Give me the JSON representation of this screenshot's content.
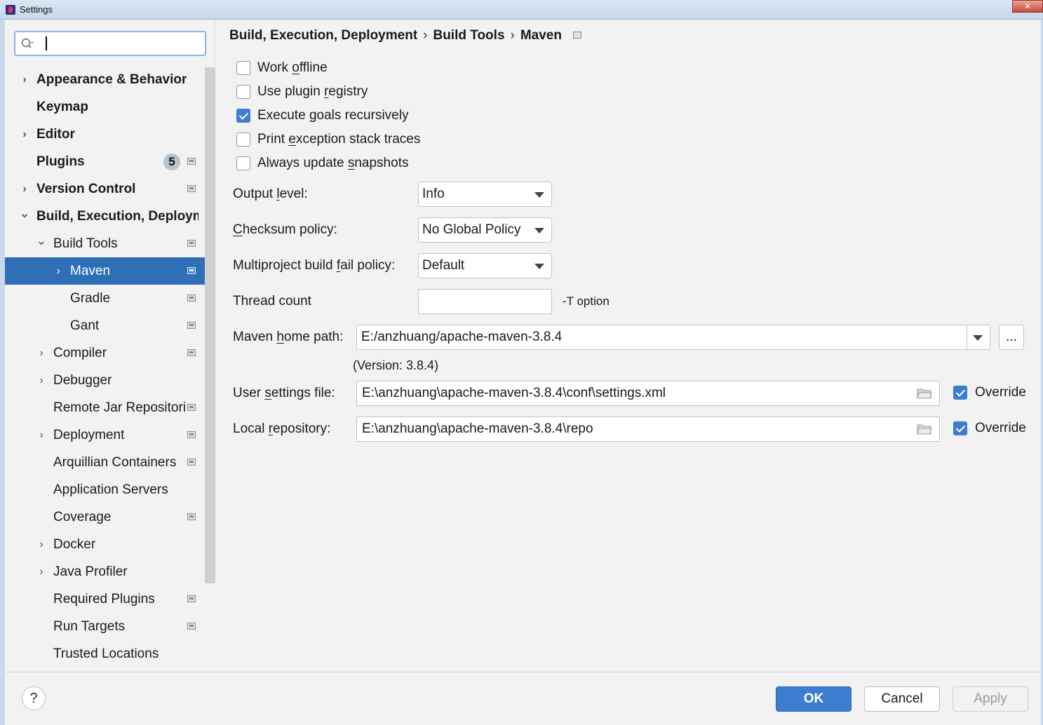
{
  "window": {
    "title": "Settings",
    "close_symbol": "✕"
  },
  "search": {
    "placeholder": "",
    "value": ""
  },
  "sidebar": {
    "items": [
      {
        "label": "Appearance & Behavior",
        "bold": true,
        "chevron": "›",
        "level": 0
      },
      {
        "label": "Keymap",
        "bold": true,
        "chevron": "",
        "level": 0
      },
      {
        "label": "Editor",
        "bold": true,
        "chevron": "›",
        "level": 0
      },
      {
        "label": "Plugins",
        "bold": true,
        "chevron": "",
        "level": 0,
        "badge": "5",
        "project_icon": true
      },
      {
        "label": "Version Control",
        "bold": true,
        "chevron": "›",
        "level": 0,
        "project_icon": true
      },
      {
        "label": "Build, Execution, Deploym",
        "bold": true,
        "chevron": "⌄",
        "level": 0
      },
      {
        "label": "Build Tools",
        "bold": false,
        "chevron": "⌄",
        "level": 1,
        "project_icon": true
      },
      {
        "label": "Maven",
        "bold": false,
        "chevron": "›",
        "level": 2,
        "project_icon": true,
        "selected": true
      },
      {
        "label": "Gradle",
        "bold": false,
        "chevron": "",
        "level": 2,
        "project_icon": true
      },
      {
        "label": "Gant",
        "bold": false,
        "chevron": "",
        "level": 2,
        "project_icon": true
      },
      {
        "label": "Compiler",
        "bold": false,
        "chevron": "›",
        "level": 1,
        "project_icon": true
      },
      {
        "label": "Debugger",
        "bold": false,
        "chevron": "›",
        "level": 1
      },
      {
        "label": "Remote Jar Repositori",
        "bold": false,
        "chevron": "",
        "level": 1,
        "project_icon": true
      },
      {
        "label": "Deployment",
        "bold": false,
        "chevron": "›",
        "level": 1,
        "project_icon": true
      },
      {
        "label": "Arquillian Containers",
        "bold": false,
        "chevron": "",
        "level": 1,
        "project_icon": true
      },
      {
        "label": "Application Servers",
        "bold": false,
        "chevron": "",
        "level": 1
      },
      {
        "label": "Coverage",
        "bold": false,
        "chevron": "",
        "level": 1,
        "project_icon": true
      },
      {
        "label": "Docker",
        "bold": false,
        "chevron": "›",
        "level": 1
      },
      {
        "label": "Java Profiler",
        "bold": false,
        "chevron": "›",
        "level": 1
      },
      {
        "label": "Required Plugins",
        "bold": false,
        "chevron": "",
        "level": 1,
        "project_icon": true
      },
      {
        "label": "Run Targets",
        "bold": false,
        "chevron": "",
        "level": 1,
        "project_icon": true
      },
      {
        "label": "Trusted Locations",
        "bold": false,
        "chevron": "",
        "level": 1
      }
    ]
  },
  "breadcrumb": {
    "parts": [
      "Build, Execution, Deployment",
      "Build Tools",
      "Maven"
    ],
    "separator": "›"
  },
  "checkboxes": [
    {
      "label": "Work offline",
      "checked": false
    },
    {
      "label": "Use plugin registry",
      "checked": false
    },
    {
      "label": "Execute goals recursively",
      "checked": true
    },
    {
      "label": "Print exception stack traces",
      "checked": false
    },
    {
      "label": "Always update snapshots",
      "checked": false
    }
  ],
  "form": {
    "output_level": {
      "label": "Output level:",
      "value": "Info"
    },
    "checksum_policy": {
      "label": "Checksum policy:",
      "value": "No Global Policy"
    },
    "multiproject_fail": {
      "label": "Multiproject build fail policy:",
      "value": "Default"
    },
    "thread_count": {
      "label": "Thread count",
      "value": "",
      "hint": "-T option"
    },
    "maven_home": {
      "label": "Maven home path:",
      "value": "E:/anzhuang/apache-maven-3.8.4",
      "browse_label": "...",
      "version": "(Version: 3.8.4)"
    },
    "user_settings": {
      "label": "User settings file:",
      "value": "E:\\anzhuang\\apache-maven-3.8.4\\conf\\settings.xml",
      "override_label": "Override",
      "override_checked": true
    },
    "local_repo": {
      "label": "Local repository:",
      "value": "E:\\anzhuang\\apache-maven-3.8.4\\repo",
      "override_label": "Override",
      "override_checked": true
    }
  },
  "buttons": {
    "help": "?",
    "ok": "OK",
    "cancel": "Cancel",
    "apply": "Apply"
  },
  "colors": {
    "selection": "#2f6fb8",
    "primary_button": "#3d7dd0",
    "checkbox_checked": "#3d7dd0"
  }
}
